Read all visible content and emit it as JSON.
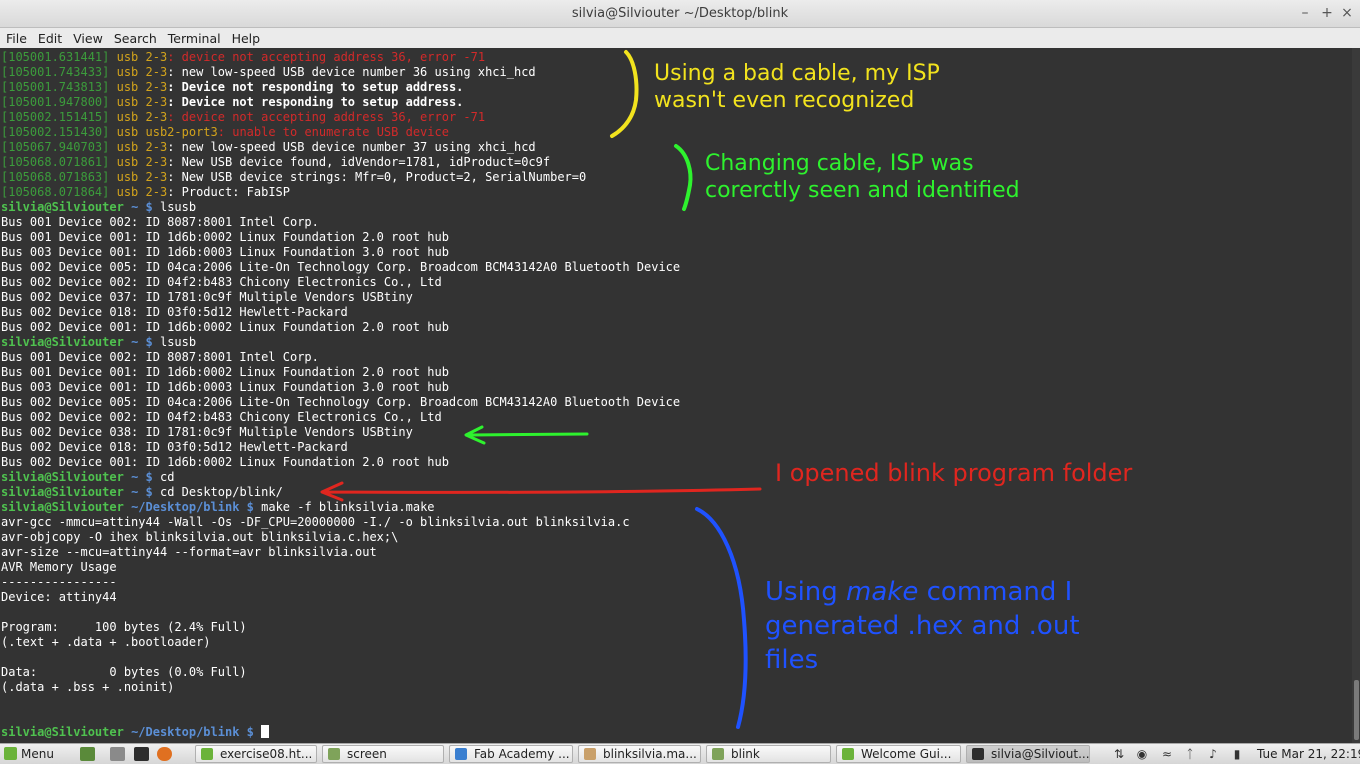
{
  "window": {
    "title": "silvia@Silviouter ~/Desktop/blink",
    "controls": [
      "minimize",
      "maximize",
      "close"
    ]
  },
  "menu": [
    "File",
    "Edit",
    "View",
    "Search",
    "Terminal",
    "Help"
  ],
  "terminal": {
    "kernel_log": [
      {
        "ts": "[105001.631441]",
        "dev": "usb 2-3",
        "msg": ": device not accepting address 36, error -71",
        "style": "error"
      },
      {
        "ts": "[105001.743433]",
        "dev": "usb 2-3",
        "msg": ": new low-speed USB device number 36 using xhci_hcd",
        "style": "normal"
      },
      {
        "ts": "[105001.743813]",
        "dev": "usb 2-3",
        "msg": ": Device not responding to setup address.",
        "style": "bold"
      },
      {
        "ts": "[105001.947800]",
        "dev": "usb 2-3",
        "msg": ": Device not responding to setup address.",
        "style": "bold"
      },
      {
        "ts": "[105002.151415]",
        "dev": "usb 2-3",
        "msg": ": device not accepting address 36, error -71",
        "style": "error"
      },
      {
        "ts": "[105002.151430]",
        "dev": "usb usb2-port3",
        "msg": ": unable to enumerate USB device",
        "style": "error"
      },
      {
        "ts": "[105067.940703]",
        "dev": "usb 2-3",
        "msg": ": new low-speed USB device number 37 using xhci_hcd",
        "style": "normal"
      },
      {
        "ts": "[105068.071861]",
        "dev": "usb 2-3",
        "msg": ": New USB device found, idVendor=1781, idProduct=0c9f",
        "style": "normal"
      },
      {
        "ts": "[105068.071863]",
        "dev": "usb 2-3",
        "msg": ": New USB device strings: Mfr=0, Product=2, SerialNumber=0",
        "style": "normal"
      },
      {
        "ts": "[105068.071864]",
        "dev": "usb 2-3",
        "msg": ": Product: FabISP",
        "style": "normal"
      }
    ],
    "prompt_user": "silvia@Silviouter",
    "prompt_home": "~ $",
    "prompt_blink": "~/Desktop/blink $",
    "cmd_lsusb": "lsusb",
    "lsusb_1": [
      "Bus 001 Device 002: ID 8087:8001 Intel Corp.",
      "Bus 001 Device 001: ID 1d6b:0002 Linux Foundation 2.0 root hub",
      "Bus 003 Device 001: ID 1d6b:0003 Linux Foundation 3.0 root hub",
      "Bus 002 Device 005: ID 04ca:2006 Lite-On Technology Corp. Broadcom BCM43142A0 Bluetooth Device",
      "Bus 002 Device 002: ID 04f2:b483 Chicony Electronics Co., Ltd",
      "Bus 002 Device 037: ID 1781:0c9f Multiple Vendors USBtiny",
      "Bus 002 Device 018: ID 03f0:5d12 Hewlett-Packard",
      "Bus 002 Device 001: ID 1d6b:0002 Linux Foundation 2.0 root hub"
    ],
    "lsusb_2": [
      "Bus 001 Device 002: ID 8087:8001 Intel Corp.",
      "Bus 001 Device 001: ID 1d6b:0002 Linux Foundation 2.0 root hub",
      "Bus 003 Device 001: ID 1d6b:0003 Linux Foundation 3.0 root hub",
      "Bus 002 Device 005: ID 04ca:2006 Lite-On Technology Corp. Broadcom BCM43142A0 Bluetooth Device",
      "Bus 002 Device 002: ID 04f2:b483 Chicony Electronics Co., Ltd",
      "Bus 002 Device 038: ID 1781:0c9f Multiple Vendors USBtiny",
      "Bus 002 Device 018: ID 03f0:5d12 Hewlett-Packard",
      "Bus 002 Device 001: ID 1d6b:0002 Linux Foundation 2.0 root hub"
    ],
    "cmd_cd": "cd",
    "cmd_cd_blink": "cd Desktop/blink/",
    "cmd_make": "make -f blinksilvia.make",
    "make_output": [
      "avr-gcc -mmcu=attiny44 -Wall -Os -DF_CPU=20000000 -I./ -o blinksilvia.out blinksilvia.c",
      "avr-objcopy -O ihex blinksilvia.out blinksilvia.c.hex;\\",
      "avr-size --mcu=attiny44 --format=avr blinksilvia.out",
      "AVR Memory Usage",
      "----------------",
      "Device: attiny44",
      "",
      "Program:     100 bytes (2.4% Full)",
      "(.text + .data + .bootloader)",
      "",
      "Data:          0 bytes (0.0% Full)",
      "(.data + .bss + .noinit)",
      "",
      ""
    ]
  },
  "annotations": {
    "yellow": "Using a bad cable, my ISP\nwasn't even recognized",
    "green": "Changing cable, ISP was\ncorerctly seen and identified",
    "red": "I opened blink program folder",
    "blue_pre": "Using ",
    "blue_em": "make",
    "blue_post": " command I\ngenerated .hex and .out\nfiles",
    "colors": {
      "yellow": "#f2e31e",
      "green": "#2ef22e",
      "red": "#e0261f",
      "blue": "#1f52ff"
    }
  },
  "taskbar": {
    "menu_label": "Menu",
    "tasks": [
      "exercise08.ht...",
      "screen",
      "Fab Academy ...",
      "blinksilvia.ma...",
      "blink",
      "Welcome Gui...",
      "silvia@Silviout..."
    ],
    "clock": "Tue Mar 21, 22:19"
  }
}
